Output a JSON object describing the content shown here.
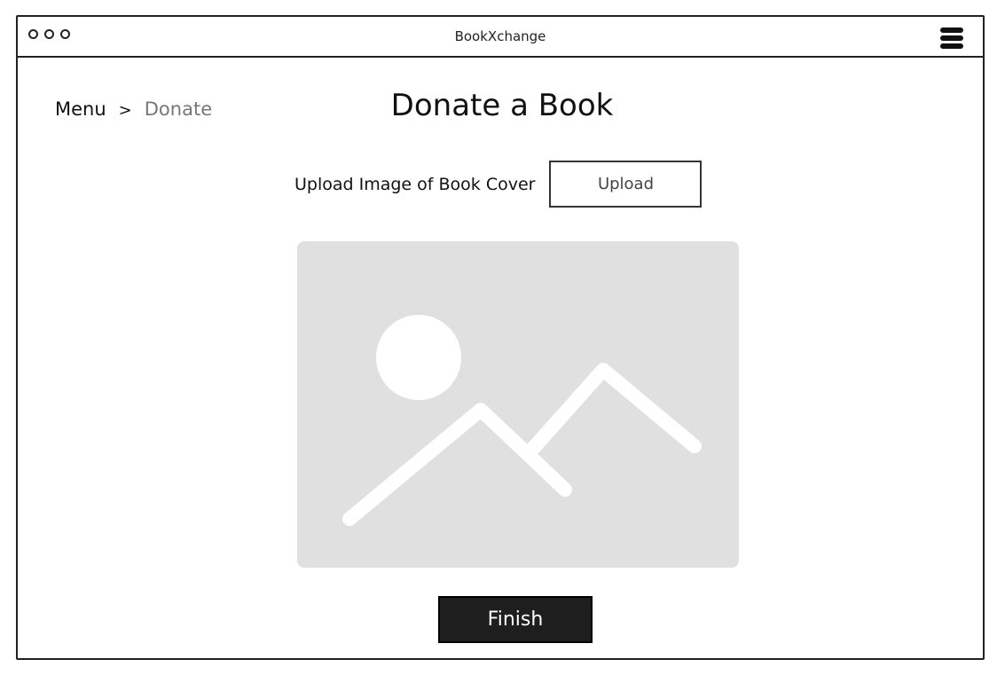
{
  "window": {
    "title": "BookXchange"
  },
  "breadcrumb": {
    "items": [
      "Menu",
      "Donate"
    ],
    "separator": ">"
  },
  "page": {
    "title": "Donate a Book"
  },
  "upload": {
    "label": "Upload Image of Book Cover",
    "button_label": "Upload"
  },
  "preview": {
    "icon": "image-placeholder-icon"
  },
  "actions": {
    "finish_label": "Finish"
  },
  "colors": {
    "placeholder_bg": "#e0e0e0",
    "button_dark": "#1e1e1e",
    "breadcrumb_current": "#777777"
  }
}
